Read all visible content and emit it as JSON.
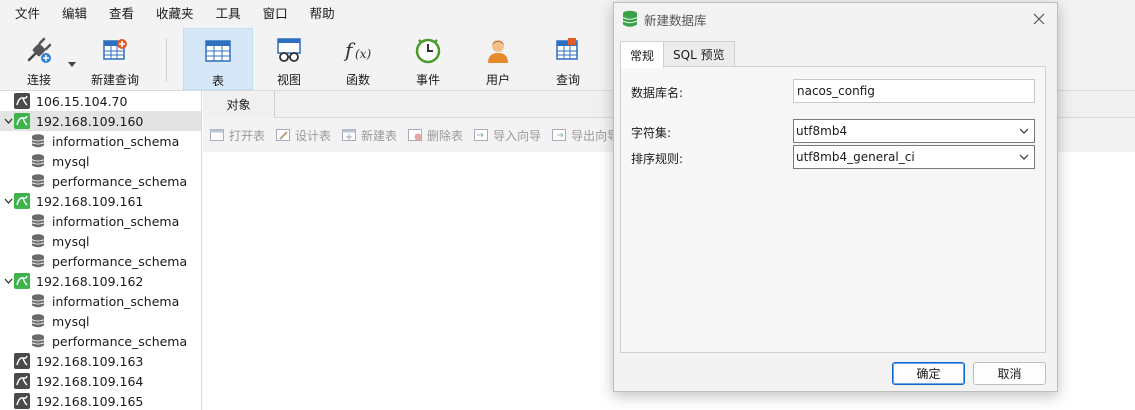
{
  "menubar": [
    "文件",
    "编辑",
    "查看",
    "收藏夹",
    "工具",
    "窗口",
    "帮助"
  ],
  "toolbar": {
    "connect": "连接",
    "new_query": "新建查询",
    "table": "表",
    "view": "视图",
    "function": "函数",
    "event": "事件",
    "user": "用户",
    "query": "查询"
  },
  "tree": [
    {
      "label": "106.15.104.70",
      "type": "connection",
      "expanded": false
    },
    {
      "label": "192.168.109.160",
      "type": "connection",
      "expanded": true,
      "selected": true
    },
    {
      "label": "information_schema",
      "type": "database"
    },
    {
      "label": "mysql",
      "type": "database"
    },
    {
      "label": "performance_schema",
      "type": "database"
    },
    {
      "label": "192.168.109.161",
      "type": "connection",
      "expanded": true
    },
    {
      "label": "information_schema",
      "type": "database"
    },
    {
      "label": "mysql",
      "type": "database"
    },
    {
      "label": "performance_schema",
      "type": "database"
    },
    {
      "label": "192.168.109.162",
      "type": "connection",
      "expanded": true
    },
    {
      "label": "information_schema",
      "type": "database"
    },
    {
      "label": "mysql",
      "type": "database"
    },
    {
      "label": "performance_schema",
      "type": "database"
    },
    {
      "label": "192.168.109.163",
      "type": "connection",
      "expanded": false
    },
    {
      "label": "192.168.109.164",
      "type": "connection",
      "expanded": false
    },
    {
      "label": "192.168.109.165",
      "type": "connection",
      "expanded": false
    }
  ],
  "objects": {
    "tab": "对象",
    "toolbar": [
      "打开表",
      "设计表",
      "新建表",
      "删除表",
      "导入向导",
      "导出向导"
    ]
  },
  "dialog": {
    "title": "新建数据库",
    "tabs": [
      "常规",
      "SQL 预览"
    ],
    "db_name_label": "数据库名:",
    "db_name_value": "nacos_config",
    "charset_label": "字符集:",
    "charset_value": "utf8mb4",
    "collation_label": "排序规则:",
    "collation_value": "utf8mb4_general_ci",
    "ok": "确定",
    "cancel": "取消"
  },
  "colors": {
    "connection_green": "#3cb44b",
    "active_tool": "#d6e8f8",
    "primary_border": "#0f66c7"
  }
}
